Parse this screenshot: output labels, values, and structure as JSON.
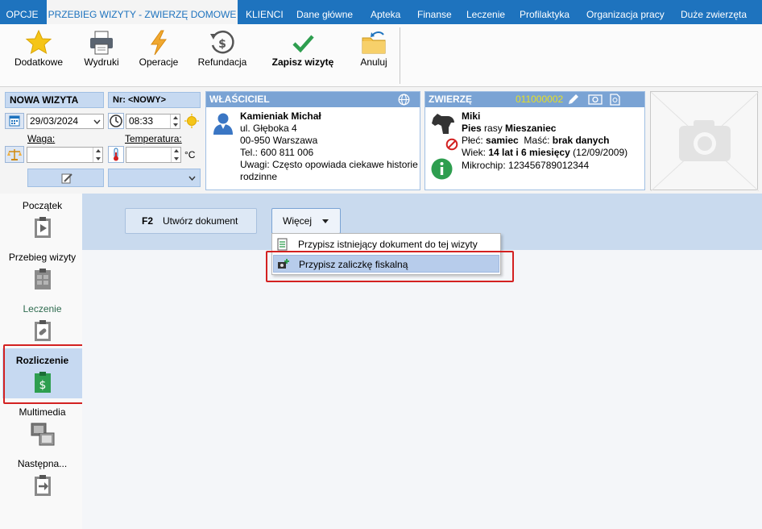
{
  "menu": {
    "items": [
      {
        "label": "OPCJE"
      },
      {
        "label": "PRZEBIEG WIZYTY - ZWIERZĘ DOMOWE"
      },
      {
        "label": "KLIENCI"
      },
      {
        "label": "Dane główne"
      },
      {
        "label": "Apteka"
      },
      {
        "label": "Finanse"
      },
      {
        "label": "Leczenie"
      },
      {
        "label": "Profilaktyka"
      },
      {
        "label": "Organizacja pracy"
      },
      {
        "label": "Duże zwierzęta"
      }
    ]
  },
  "ribbon": {
    "dodatkowe": "Dodatkowe",
    "wydruki": "Wydruki",
    "operacje": "Operacje",
    "refundacja": "Refundacja",
    "zapisz": "Zapisz wizytę",
    "anuluj": "Anuluj"
  },
  "visit": {
    "title": "NOWA WIZYTA",
    "number": "Nr: <NOWY>",
    "date": "29/03/2024",
    "time": "08:33",
    "weight_label": "Waga:",
    "temp_label": "Temperatura:",
    "temp_unit": "°C",
    "weight_value": "",
    "temp_value": ""
  },
  "owner": {
    "header": "WŁAŚCICIEL",
    "name": "Kamieniak Michał",
    "street": "ul. Głęboka 4",
    "city": "00-950  Warszawa",
    "phone": "Tel.: 600 811 006",
    "notes_line1": "Uwagi: Często opowiada ciekawe historie",
    "notes_line2": "rodzinne"
  },
  "animal": {
    "header": "ZWIERZĘ",
    "id": "011000002",
    "name": "Miki",
    "species": "Pies",
    "breed_word": "rasy",
    "breed": "Mieszaniec",
    "sex_label": "Płeć:",
    "sex": "samiec",
    "color_label": "Maść:",
    "color": "brak danych",
    "age_label": "Wiek:",
    "age": "14 lat i 6 miesięcy",
    "birth": "(12/09/2009)",
    "chip": "Mikrochip: 123456789012344"
  },
  "nav": {
    "items": [
      {
        "label": "Początek"
      },
      {
        "label": "Przebieg wizyty"
      },
      {
        "label": "Leczenie"
      },
      {
        "label": "Rozliczenie"
      },
      {
        "label": "Multimedia"
      },
      {
        "label": "Następna..."
      }
    ]
  },
  "toolbar": {
    "create_key": "F2",
    "create_label": "Utwórz dokument",
    "more_label": "Więcej"
  },
  "dropdown": {
    "items": [
      {
        "label": "Przypisz istniejący dokument do tej wizyty"
      },
      {
        "label": "Przypisz zaliczkę fiskalną"
      }
    ]
  },
  "colors": {
    "menu_bg": "#1e73be",
    "accent_green": "#2e9e4f",
    "highlight_red": "#d32121",
    "chip_id_yellow": "#e8e020"
  }
}
